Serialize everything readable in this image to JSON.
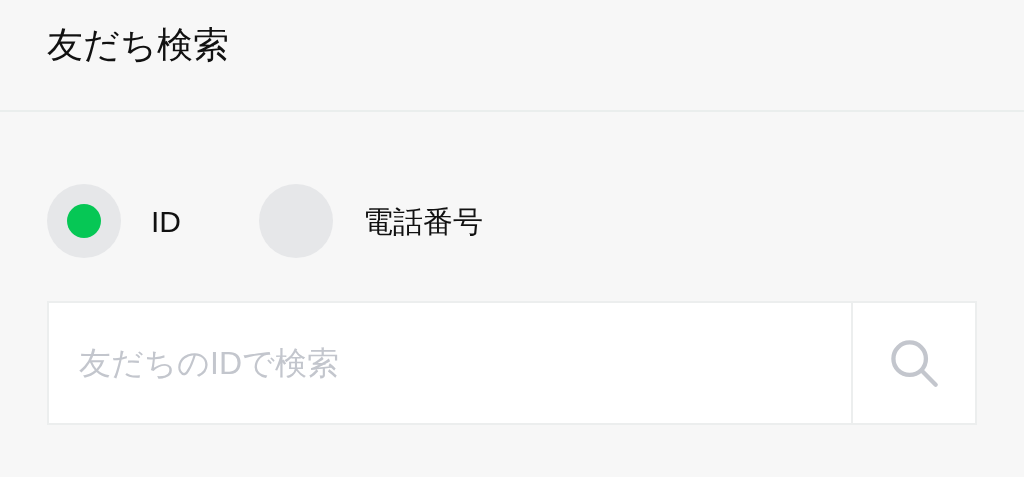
{
  "header": {
    "title": "友だち検索"
  },
  "search_types": [
    {
      "label": "ID",
      "selected": true
    },
    {
      "label": "電話番号",
      "selected": false
    }
  ],
  "search": {
    "placeholder": "友だちのIDで検索"
  }
}
